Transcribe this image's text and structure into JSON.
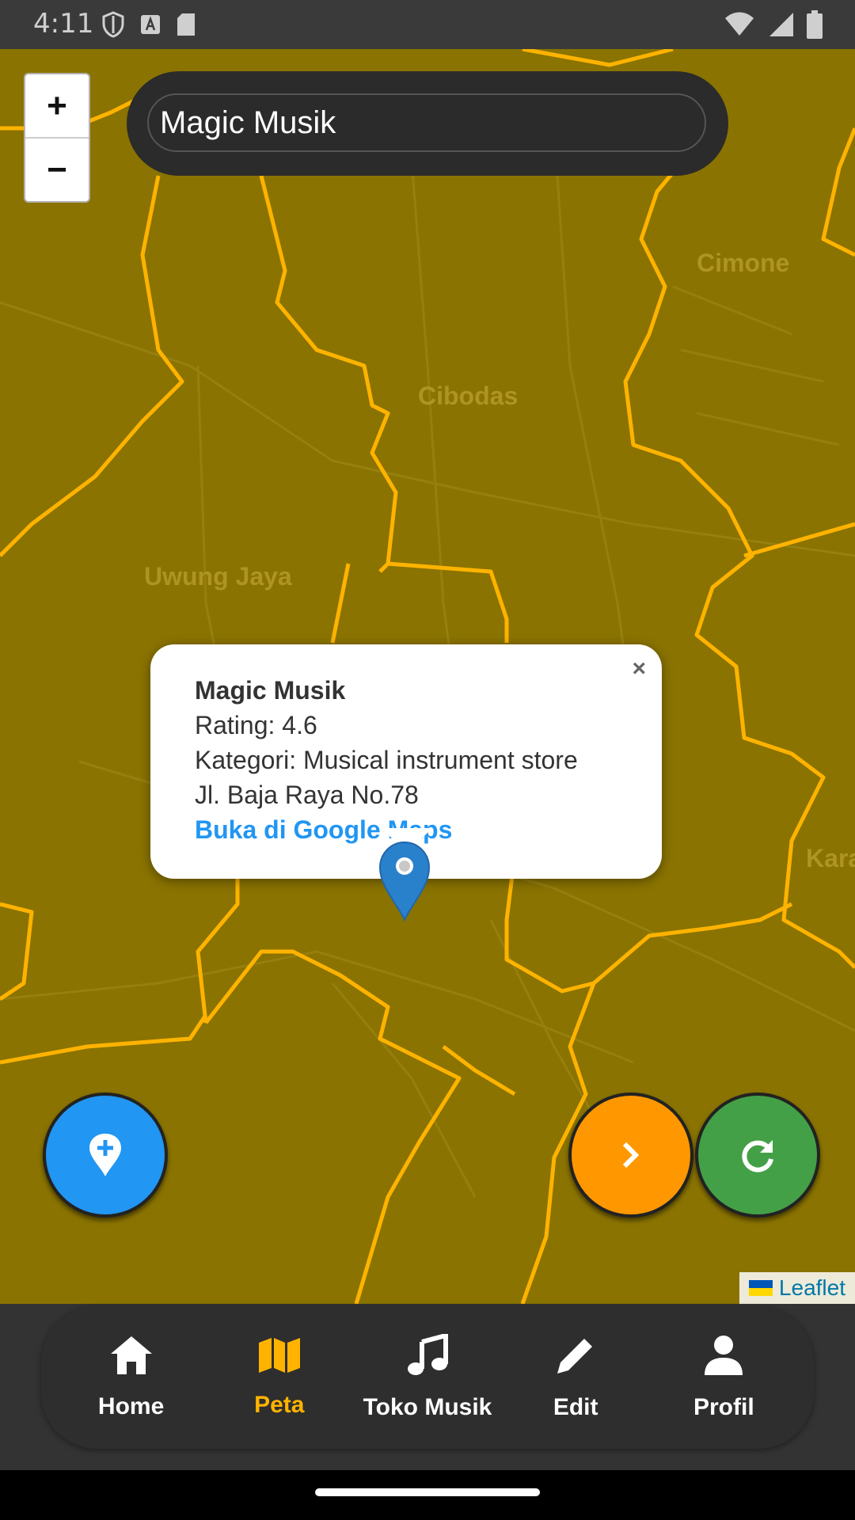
{
  "status": {
    "time": "4:11"
  },
  "search": {
    "value": "Magic Musik"
  },
  "zoom": {
    "in_label": "+",
    "out_label": "−"
  },
  "map": {
    "places": [
      "Cimone",
      "Cibodas",
      "Uwung Jaya",
      "Karav"
    ]
  },
  "popup": {
    "title": "Magic Musik",
    "rating": "Rating: 4.6",
    "category": "Kategori: Musical instrument store",
    "address": "Jl. Baja Raya No.78",
    "link": "Buka di Google Maps",
    "close": "×"
  },
  "attribution": {
    "label": "Leaflet"
  },
  "nav": {
    "items": [
      {
        "label": "Home",
        "icon": "home-icon"
      },
      {
        "label": "Peta",
        "icon": "map-icon"
      },
      {
        "label": "Toko Musik",
        "icon": "music-note-icon"
      },
      {
        "label": "Edit",
        "icon": "pencil-icon"
      },
      {
        "label": "Profil",
        "icon": "person-icon"
      }
    ],
    "active": "Peta"
  },
  "colors": {
    "map": "#8a7300",
    "roads": "#ffb300",
    "accent": "#ffb300",
    "fab_add": "#2196f3",
    "fab_next": "#ff9800",
    "fab_refresh": "#43a047"
  }
}
